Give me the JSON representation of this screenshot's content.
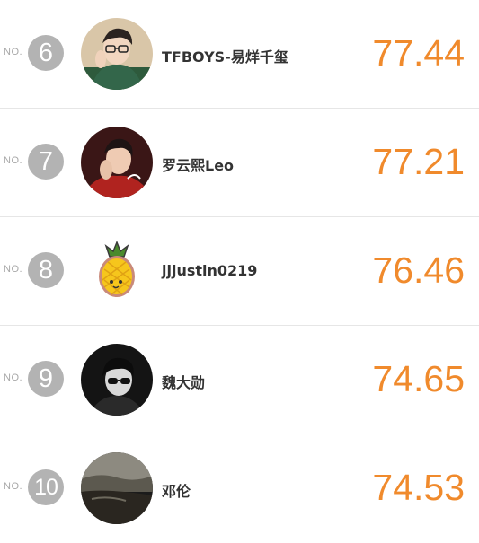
{
  "ranking": {
    "no_label": "NO.",
    "entries": [
      {
        "rank": "6",
        "name": "TFBOYS-易烊千玺",
        "score": "77.44",
        "avatar": "photo-avatar-boy-green-jacket"
      },
      {
        "rank": "7",
        "name": "罗云熙Leo",
        "score": "77.21",
        "avatar": "photo-avatar-boy-red-jacket"
      },
      {
        "rank": "8",
        "name": "jjjustin0219",
        "score": "76.46",
        "avatar": "pineapple-sticker-icon"
      },
      {
        "rank": "9",
        "name": "魏大勋",
        "score": "74.65",
        "avatar": "photo-avatar-sunglasses-bw"
      },
      {
        "rank": "10",
        "name": "邓伦",
        "score": "74.53",
        "avatar": "photo-avatar-landscape-dark"
      }
    ]
  },
  "colors": {
    "score": "#f08a2c",
    "rank_circle": "#b3b3b3",
    "name": "#333333",
    "divider": "#e6e6e6"
  }
}
